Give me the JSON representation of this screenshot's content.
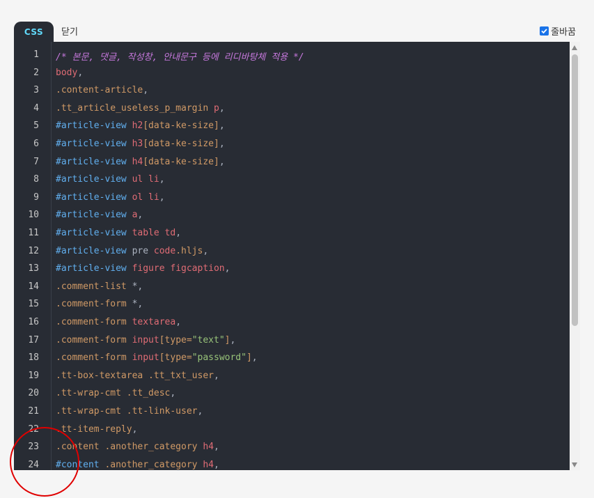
{
  "tabs": {
    "active_label": "CSS",
    "close_label": "닫기"
  },
  "options": {
    "wrap_label": "줄바꿈",
    "wrap_checked": true
  },
  "editor": {
    "line_numbers": [
      "1",
      "2",
      "3",
      "4",
      "5",
      "6",
      "7",
      "8",
      "9",
      "10",
      "11",
      "12",
      "13",
      "14",
      "15",
      "16",
      "17",
      "18",
      "19",
      "20",
      "21",
      "22",
      "23",
      "24"
    ],
    "lines": [
      [
        [
          "/* 본문, 댓글, 작성창, 안내문구 등에 리디바탕체 적용 */",
          "comment"
        ]
      ],
      [
        [
          "body",
          "tag"
        ],
        [
          ",",
          "punc"
        ]
      ],
      [
        [
          ".content-article",
          "cls"
        ],
        [
          ",",
          "punc"
        ]
      ],
      [
        [
          ".tt_article_useless_p_margin",
          "cls"
        ],
        [
          " ",
          "punc"
        ],
        [
          "p",
          "tag"
        ],
        [
          ",",
          "punc"
        ]
      ],
      [
        [
          "#article-view",
          "id"
        ],
        [
          " ",
          "punc"
        ],
        [
          "h2",
          "tag"
        ],
        [
          "[data-ke-size]",
          "cls"
        ],
        [
          ",",
          "punc"
        ]
      ],
      [
        [
          "#article-view",
          "id"
        ],
        [
          " ",
          "punc"
        ],
        [
          "h3",
          "tag"
        ],
        [
          "[data-ke-size]",
          "cls"
        ],
        [
          ",",
          "punc"
        ]
      ],
      [
        [
          "#article-view",
          "id"
        ],
        [
          " ",
          "punc"
        ],
        [
          "h4",
          "tag"
        ],
        [
          "[data-ke-size]",
          "cls"
        ],
        [
          ",",
          "punc"
        ]
      ],
      [
        [
          "#article-view",
          "id"
        ],
        [
          " ",
          "punc"
        ],
        [
          "ul li",
          "tag"
        ],
        [
          ",",
          "punc"
        ]
      ],
      [
        [
          "#article-view",
          "id"
        ],
        [
          " ",
          "punc"
        ],
        [
          "ol li",
          "tag"
        ],
        [
          ",",
          "punc"
        ]
      ],
      [
        [
          "#article-view",
          "id"
        ],
        [
          " ",
          "punc"
        ],
        [
          "a",
          "tag"
        ],
        [
          ",",
          "punc"
        ]
      ],
      [
        [
          "#article-view",
          "id"
        ],
        [
          " ",
          "punc"
        ],
        [
          "table td",
          "tag"
        ],
        [
          ",",
          "punc"
        ]
      ],
      [
        [
          "#article-view",
          "id"
        ],
        [
          " pre ",
          "punc"
        ],
        [
          "code",
          "tag"
        ],
        [
          ".hljs",
          "cls"
        ],
        [
          ",",
          "punc"
        ]
      ],
      [
        [
          "#article-view",
          "id"
        ],
        [
          " ",
          "punc"
        ],
        [
          "figure figcaption",
          "tag"
        ],
        [
          ",",
          "punc"
        ]
      ],
      [
        [
          ".comment-list",
          "cls"
        ],
        [
          " *,",
          "punc"
        ]
      ],
      [
        [
          ".comment-form",
          "cls"
        ],
        [
          " *,",
          "punc"
        ]
      ],
      [
        [
          ".comment-form",
          "cls"
        ],
        [
          " ",
          "punc"
        ],
        [
          "textarea",
          "tag"
        ],
        [
          ",",
          "punc"
        ]
      ],
      [
        [
          ".comment-form",
          "cls"
        ],
        [
          " ",
          "punc"
        ],
        [
          "input",
          "tag"
        ],
        [
          "[type=",
          "cls"
        ],
        [
          "\"text\"",
          "str"
        ],
        [
          "]",
          "cls"
        ],
        [
          ",",
          "punc"
        ]
      ],
      [
        [
          ".comment-form",
          "cls"
        ],
        [
          " ",
          "punc"
        ],
        [
          "input",
          "tag"
        ],
        [
          "[type=",
          "cls"
        ],
        [
          "\"password\"",
          "str"
        ],
        [
          "]",
          "cls"
        ],
        [
          ",",
          "punc"
        ]
      ],
      [
        [
          ".tt-box-textarea .tt_txt_user",
          "cls"
        ],
        [
          ",",
          "punc"
        ]
      ],
      [
        [
          ".tt-wrap-cmt .tt_desc",
          "cls"
        ],
        [
          ",",
          "punc"
        ]
      ],
      [
        [
          ".tt-wrap-cmt .tt-link-user",
          "cls"
        ],
        [
          ",",
          "punc"
        ]
      ],
      [
        [
          ".tt-item-reply",
          "cls"
        ],
        [
          ",",
          "punc"
        ]
      ],
      [
        [
          ".content .another_category",
          "cls"
        ],
        [
          " ",
          "punc"
        ],
        [
          "h4",
          "tag"
        ],
        [
          ",",
          "punc"
        ]
      ],
      [
        [
          "#content",
          "id"
        ],
        [
          " ",
          "punc"
        ],
        [
          ".another_category",
          "cls"
        ],
        [
          " ",
          "punc"
        ],
        [
          "h4",
          "tag"
        ],
        [
          ",",
          "punc"
        ]
      ]
    ]
  },
  "scroll_position": 0.0
}
